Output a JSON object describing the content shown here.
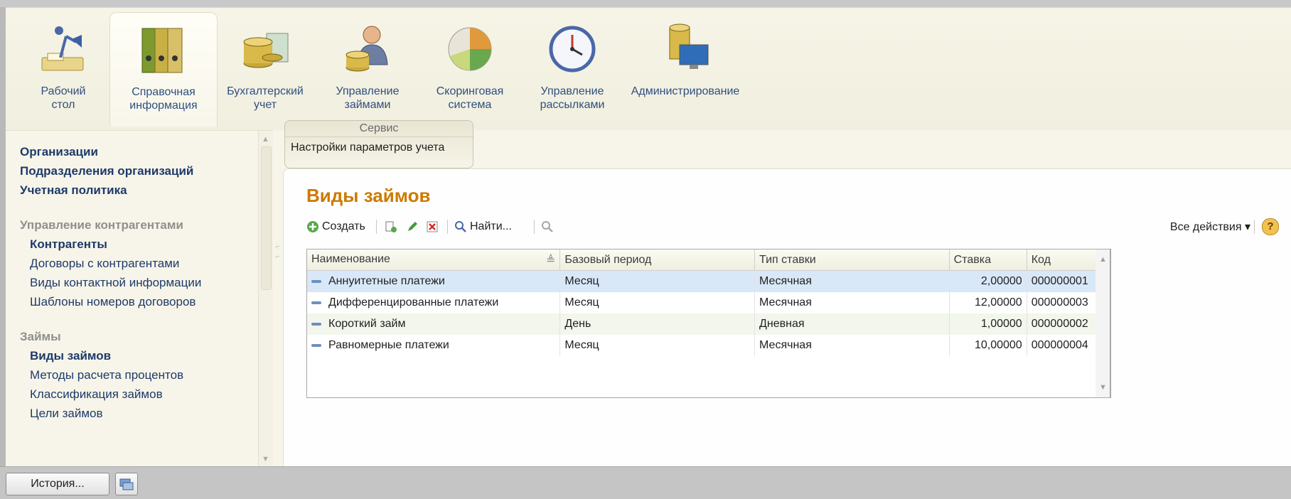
{
  "sections": [
    {
      "label": "Рабочий\nстол",
      "icon": "desk-lamp-icon"
    },
    {
      "label": "Справочная\nинформация",
      "icon": "binders-icon",
      "active": true
    },
    {
      "label": "Бухгалтерский\nучет",
      "icon": "coins-icon"
    },
    {
      "label": "Управление\nзаймами",
      "icon": "manager-coins-icon"
    },
    {
      "label": "Скоринговая\nсистема",
      "icon": "pie-chart-icon"
    },
    {
      "label": "Управление\nрассылками",
      "icon": "clock-icon"
    },
    {
      "label": "Администрирование",
      "icon": "database-monitor-icon"
    }
  ],
  "left_nav": {
    "top_links": [
      "Организации",
      "Подразделения организаций",
      "Учетная политика"
    ],
    "group1": {
      "title": "Управление контрагентами",
      "items": [
        "Контрагенты",
        "Договоры с контрагентами",
        "Виды контактной информации",
        "Шаблоны номеров договоров"
      ]
    },
    "group2": {
      "title": "Займы",
      "items": [
        "Виды займов",
        "Методы расчета процентов",
        "Классификация займов",
        "Цели займов"
      ]
    }
  },
  "service": {
    "title": "Сервис",
    "item": "Настройки параметров учета"
  },
  "form": {
    "title": "Виды займов",
    "toolbar": {
      "create": "Создать",
      "find": "Найти...",
      "all_actions": "Все действия ▾",
      "help": "?"
    },
    "columns": [
      "Наименование",
      "Базовый период",
      "Тип ставки",
      "Ставка",
      "Код"
    ],
    "rows": [
      {
        "name": "Аннуитетные платежи",
        "period": "Месяц",
        "type": "Месячная",
        "rate": "2,00000",
        "code": "000000001"
      },
      {
        "name": "Дифференцированные платежи",
        "period": "Месяц",
        "type": "Месячная",
        "rate": "12,00000",
        "code": "000000003"
      },
      {
        "name": "Короткий займ",
        "period": "День",
        "type": "Дневная",
        "rate": "1,00000",
        "code": "000000002"
      },
      {
        "name": "Равномерные платежи",
        "period": "Месяц",
        "type": "Месячная",
        "rate": "10,00000",
        "code": "000000004"
      }
    ]
  },
  "bottom": {
    "history": "История..."
  },
  "colors": {
    "accent_title": "#cc7a00",
    "link": "#1e3a6a",
    "selected_row": "#d9e8f8"
  }
}
